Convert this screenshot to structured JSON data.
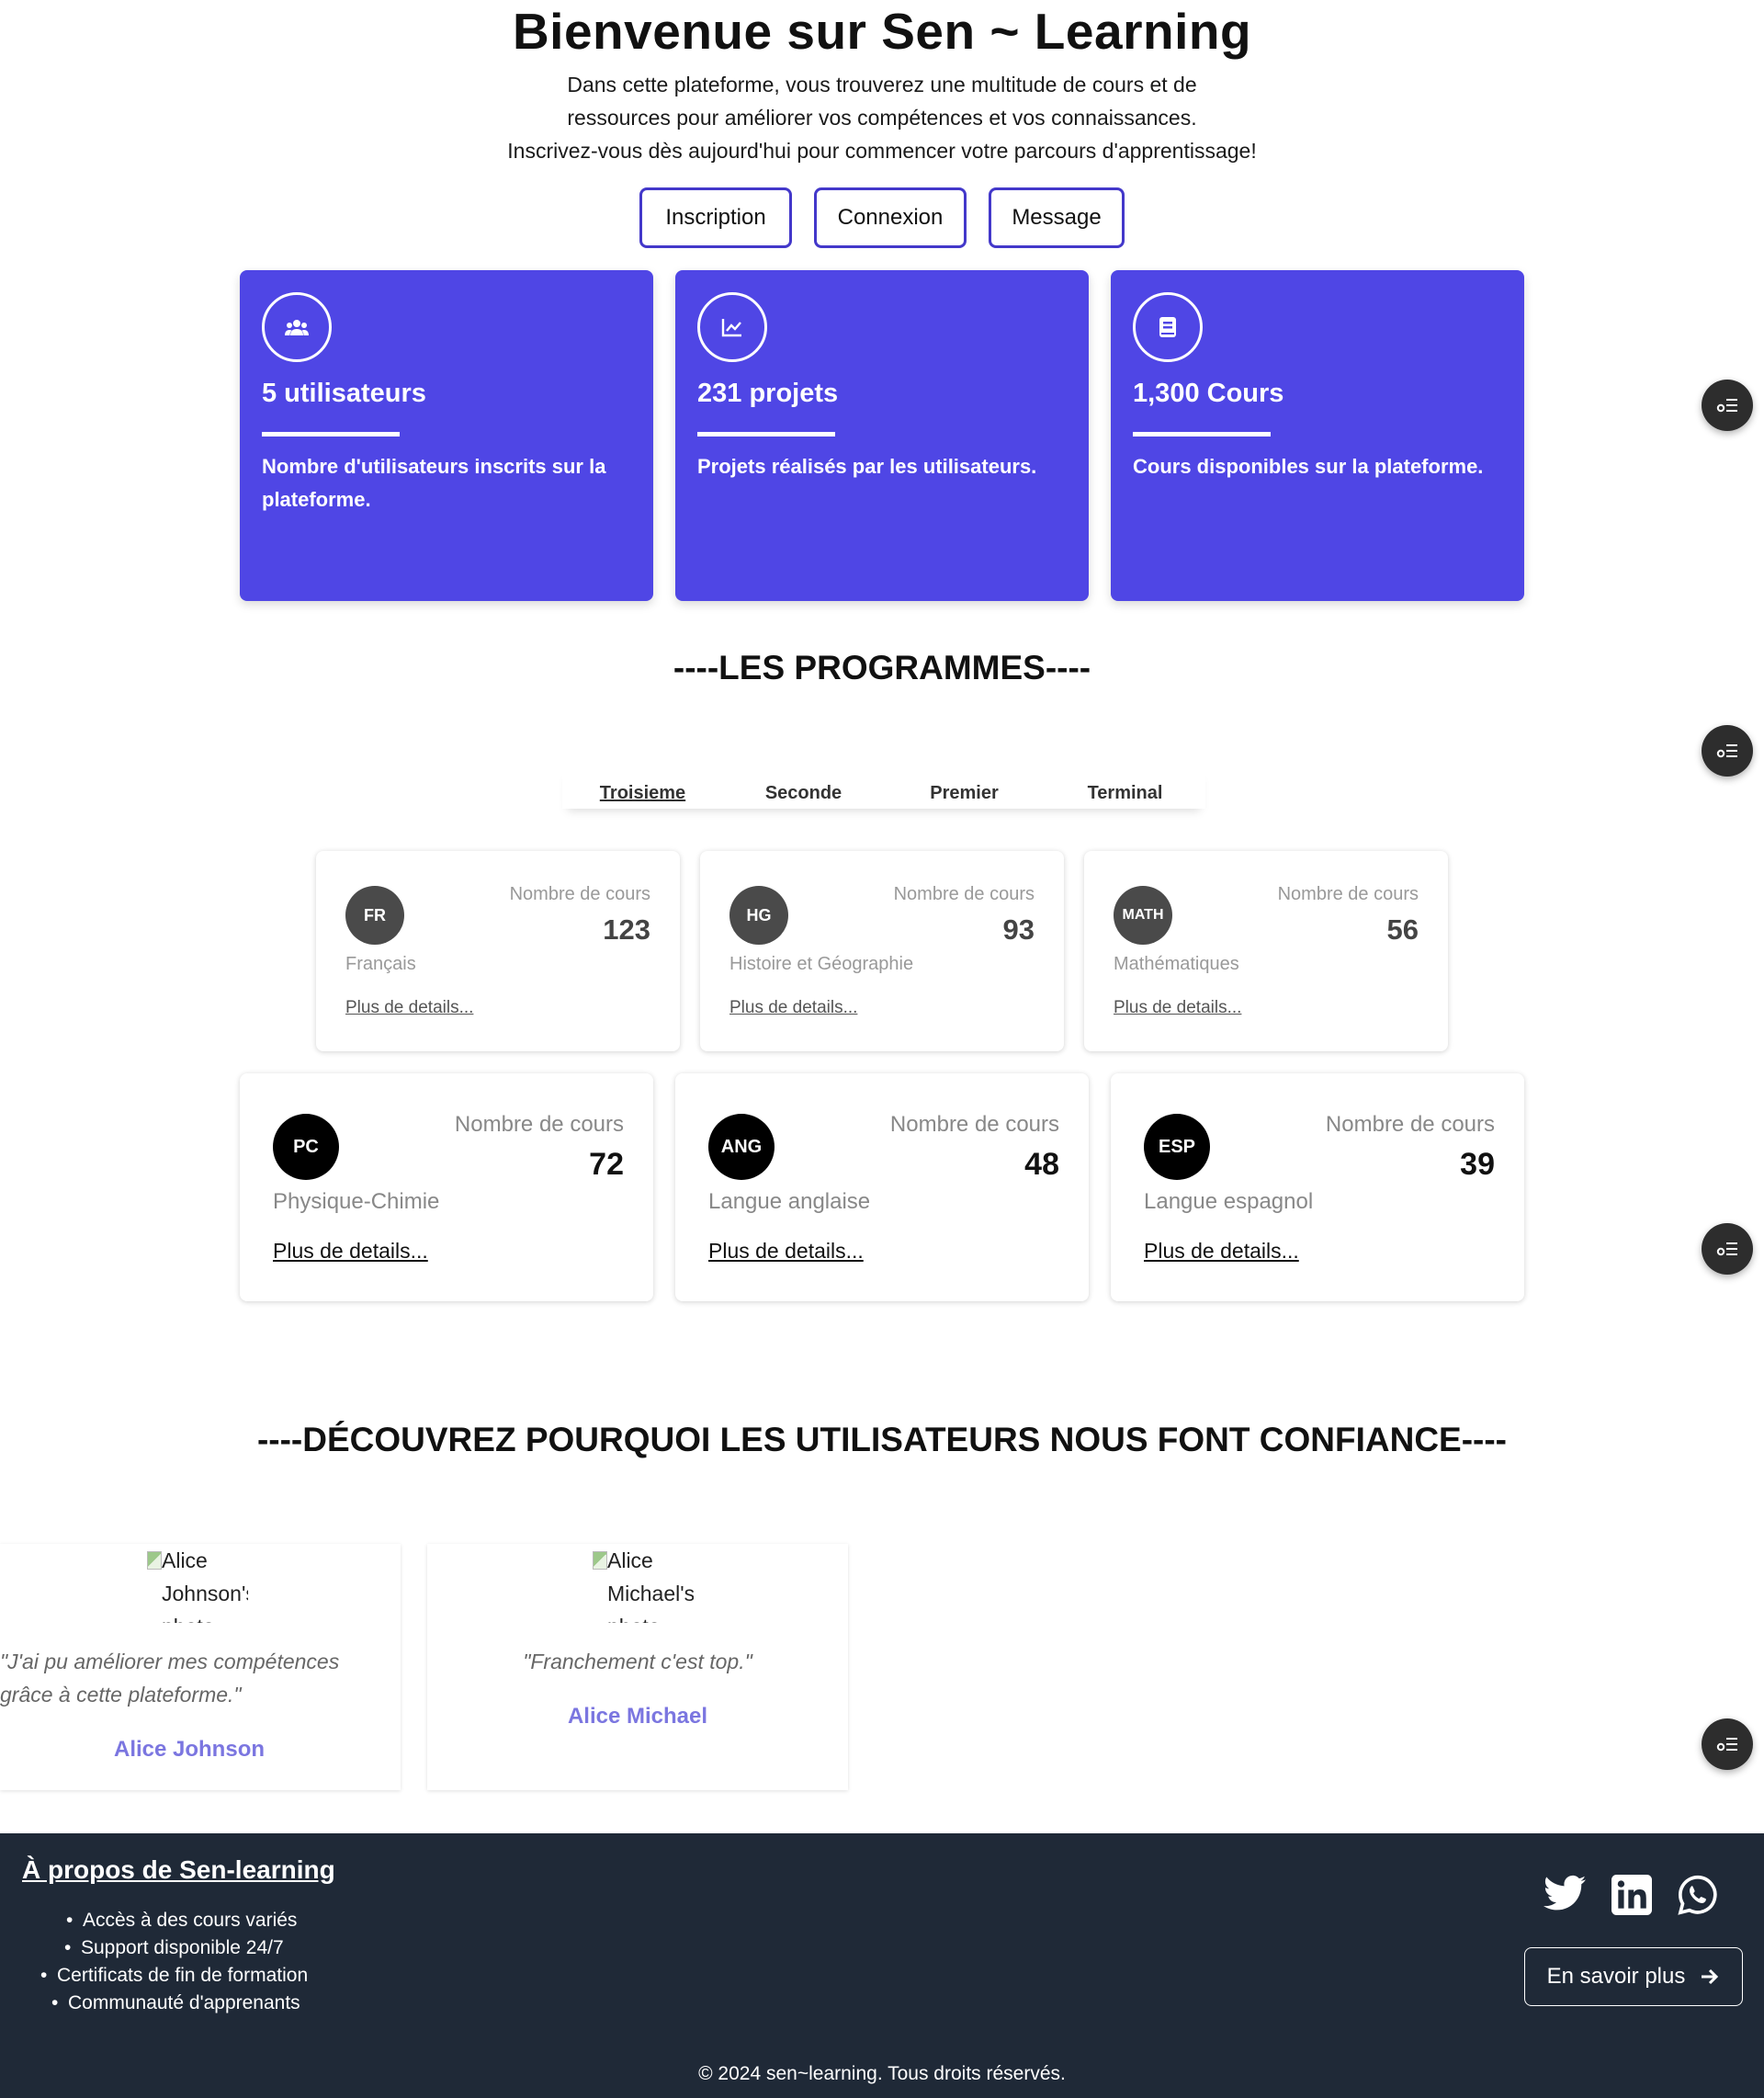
{
  "hero": {
    "title": "Bienvenue sur Sen ~ Learning",
    "desc_line1": "Dans cette plateforme, vous trouverez une multitude de cours et de",
    "desc_line2": "ressources pour améliorer vos compétences et vos connaissances.",
    "desc_line3": "Inscrivez-vous dès aujourd'hui pour commencer votre parcours d'apprentissage!",
    "buttons": [
      "Inscription",
      "Connexion",
      "Message"
    ]
  },
  "stats": [
    {
      "icon": "users-icon",
      "title": "5 utilisateurs",
      "desc": "Nombre d'utilisateurs inscrits sur la plateforme."
    },
    {
      "icon": "chart-icon",
      "title": "231 projets",
      "desc": "Projets réalisés par les utilisateurs."
    },
    {
      "icon": "book-icon",
      "title": "1,300 Cours",
      "desc": "Cours disponibles sur la plateforme."
    }
  ],
  "programmes": {
    "title": "----LES PROGRAMMES----",
    "tabs": [
      "Troisieme",
      "Seconde",
      "Premier",
      "Terminal"
    ],
    "active_tab": "Troisieme",
    "count_label": "Nombre de cours",
    "link_label": "Plus de details...",
    "courses": [
      {
        "badge": "FR",
        "name": "Français",
        "count": "123"
      },
      {
        "badge": "HG",
        "name": "Histoire et Géographie",
        "count": "93"
      },
      {
        "badge": "MATH",
        "name": "Mathématiques",
        "count": "56"
      },
      {
        "badge": "PC",
        "name": "Physique-Chimie",
        "count": "72"
      },
      {
        "badge": "ANG",
        "name": "Langue anglaise",
        "count": "48"
      },
      {
        "badge": "ESP",
        "name": "Langue espagnol",
        "count": "39"
      }
    ]
  },
  "testimonials": {
    "title": "----DÉCOUVREZ POURQUOI LES UTILISATEURS NOUS FONT CONFIANCE----",
    "items": [
      {
        "img_alt": "Alice Johnson's photo",
        "quote_line1": "\"J'ai pu améliorer mes compétences",
        "quote_line2": "grâce à cette plateforme.\"",
        "author": "Alice Johnson"
      },
      {
        "img_alt": "Alice Michael's photo",
        "quote_line1": "\"Franchement c'est top.\"",
        "quote_line2": "",
        "author": "Alice Michael"
      }
    ]
  },
  "footer": {
    "title": "À propos de Sen-learning",
    "items": [
      "Accès à des cours variés",
      "Support disponible 24/7",
      "Certificats de fin de formation",
      "Communauté d'apprenants"
    ],
    "social": [
      "twitter-icon",
      "linkedin-icon",
      "whatsapp-icon"
    ],
    "more_label": "En savoir plus",
    "copyright": "© 2024 sen~learning. Tous droits réservés."
  },
  "colors": {
    "accent": "#4f46e5",
    "footer_bg": "#1f2937",
    "author": "#7b76e0"
  }
}
